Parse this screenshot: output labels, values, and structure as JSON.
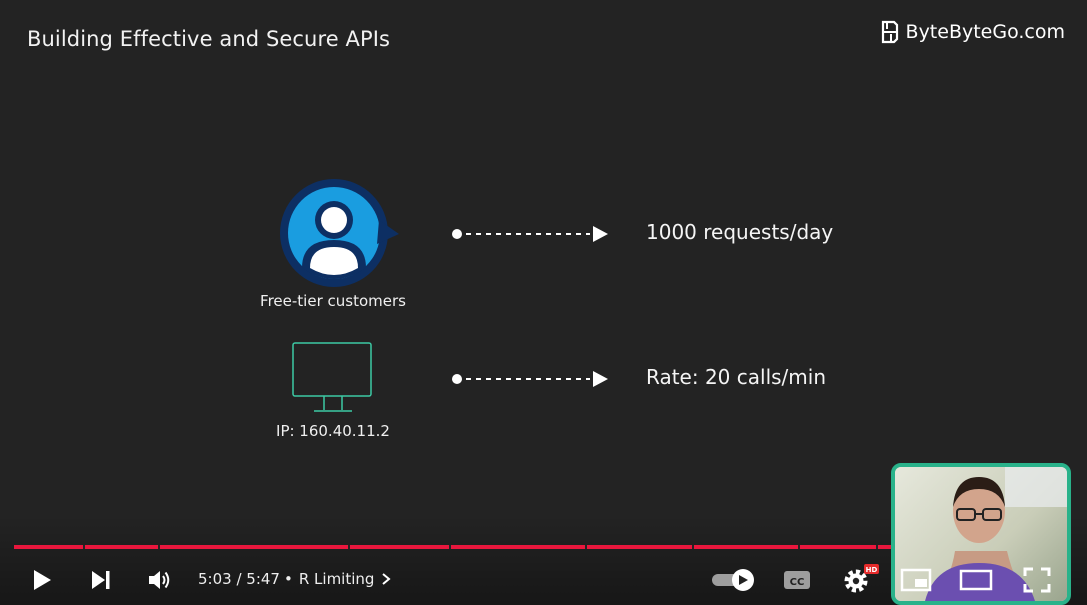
{
  "slide": {
    "title": "Building Effective and Secure APIs",
    "brand": "ByteByteGo.com"
  },
  "diagram": {
    "customer_label": "Free-tier customers",
    "ip_label": "IP: 160.40.11.2",
    "rules": [
      "1000 requests/day",
      "Rate: 20 calls/min"
    ]
  },
  "player": {
    "time_display": "5:03 / 5:47",
    "chapter_label": "R Limiting",
    "progress_fraction": 0.87,
    "settings_badge": "HD",
    "captions_label": "CC",
    "colors": {
      "accent": "#e8173d",
      "pip_border": "#29b28a",
      "icon_blue": "#1a9de0",
      "icon_navy": "#0d2f63",
      "monitor_outline": "#3cc9a4"
    }
  },
  "icons": [
    "play-icon",
    "next-icon",
    "volume-icon",
    "chevron-right-icon",
    "autoplay-toggle-icon",
    "captions-icon",
    "settings-icon",
    "miniplayer-icon",
    "theater-icon",
    "fullscreen-icon",
    "user-icon",
    "monitor-icon",
    "logo-icon"
  ]
}
